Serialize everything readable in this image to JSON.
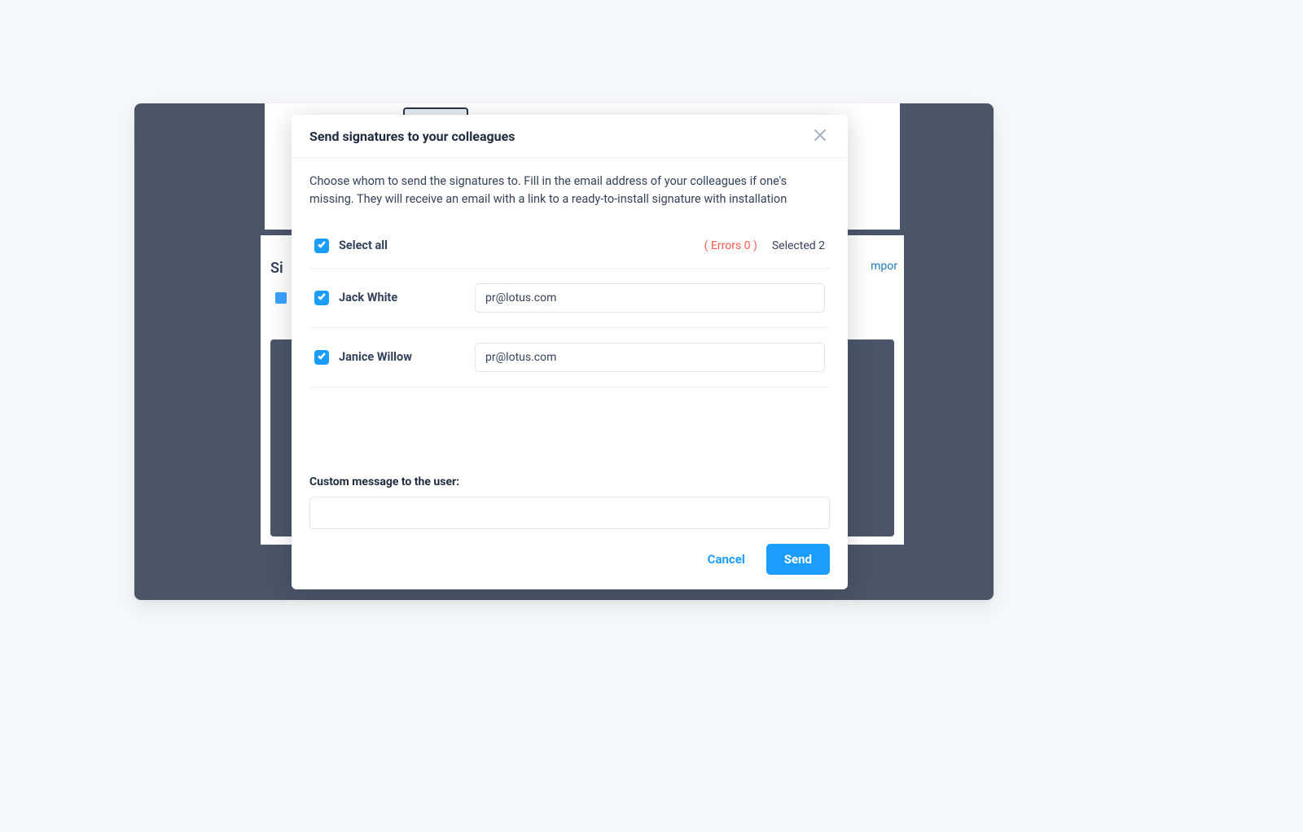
{
  "modal": {
    "title": "Send signatures to your colleagues",
    "description": "Choose whom to send the signatures to. Fill in the email address of your colleagues if one's missing. They will receive an email with a link to a ready-to-install signature with installation",
    "select_all_label": "Select all",
    "errors_label": "( Errors 0 )",
    "selected_label": "Selected 2",
    "recipients": [
      {
        "name": "Jack White",
        "email": "pr@lotus.com",
        "checked": true
      },
      {
        "name": "Janice Willow",
        "email": "pr@lotus.com",
        "checked": true
      }
    ],
    "custom_message_label": "Custom message to the user:",
    "custom_message_value": "",
    "cancel_label": "Cancel",
    "send_label": "Send"
  },
  "background": {
    "side_text_left": "Si",
    "side_text_right": "mpor"
  },
  "colors": {
    "accent": "#1a9dff",
    "error": "#ff5b4f",
    "backdrop": "#4a5568"
  }
}
